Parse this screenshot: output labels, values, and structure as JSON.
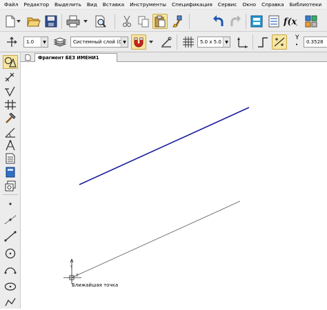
{
  "menu": {
    "items": [
      "Файл",
      "Редактор",
      "Выделить",
      "Вид",
      "Вставка",
      "Инструменты",
      "Спецификация",
      "Сервис",
      "Окно",
      "Справка",
      "Библиотеки"
    ]
  },
  "toolbar2": {
    "line_width_value": "1.0",
    "layer_value": "Системный слой (0)",
    "grid_step_value": "5.0 x 5.0",
    "y_coord_value": "0.3528"
  },
  "document": {
    "tab_title": "Фрагмент БЕЗ ИМЕНИ1"
  },
  "canvas": {
    "snap_hint": "Ближайшая точка",
    "line_colors": {
      "selected": "#1a1a9c",
      "normal": "#555555"
    }
  },
  "colors": {
    "accent": "#f6e6a0",
    "toolbar_bg": "#ececec"
  }
}
